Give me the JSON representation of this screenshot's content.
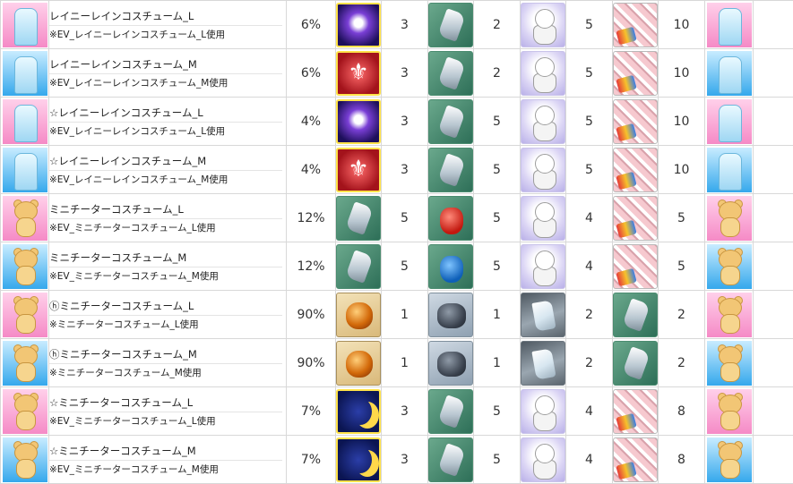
{
  "rows": [
    {
      "name": "レイニーレインコスチューム_L",
      "sub": "※EV_レイニーレインコスチューム_L使用",
      "rate": "6%",
      "costume": "pink-rain",
      "item1": "purple-orb-icon",
      "c1": "3",
      "item2": "green-crystal-icon",
      "c2": "2",
      "item3": "doll-icon",
      "c3": "5",
      "item4": "cloth-icon",
      "c4": "10",
      "result": "pink-rain"
    },
    {
      "name": "レイニーレインコスチューム_M",
      "sub": "※EV_レイニーレインコスチューム_M使用",
      "rate": "6%",
      "costume": "blue-rain",
      "item1": "red-fleur-icon",
      "c1": "3",
      "item2": "green-crystal-icon",
      "c2": "2",
      "item3": "doll-icon",
      "c3": "5",
      "item4": "cloth-icon",
      "c4": "10",
      "result": "blue-rain"
    },
    {
      "name": "☆レイニーレインコスチューム_L",
      "sub": "※EV_レイニーレインコスチューム_L使用",
      "rate": "4%",
      "costume": "pink-rain",
      "item1": "purple-orb-icon",
      "c1": "3",
      "item2": "green-crystal-icon",
      "c2": "5",
      "item3": "doll-icon",
      "c3": "5",
      "item4": "cloth-icon",
      "c4": "10",
      "result": "pink-rain"
    },
    {
      "name": "☆レイニーレインコスチューム_M",
      "sub": "※EV_レイニーレインコスチューム_M使用",
      "rate": "4%",
      "costume": "blue-rain",
      "item1": "red-fleur-icon",
      "c1": "3",
      "item2": "green-crystal-icon",
      "c2": "5",
      "item3": "doll-icon",
      "c3": "5",
      "item4": "cloth-icon",
      "c4": "10",
      "result": "blue-rain"
    },
    {
      "name": "ミニチーターコスチューム_L",
      "sub": "※EV_ミニチーターコスチューム_L使用",
      "rate": "12%",
      "costume": "pink-bear",
      "item1": "green-crystal-icon",
      "c1": "5",
      "item2": "red-bag-icon",
      "c2": "5",
      "item3": "doll-icon",
      "c3": "4",
      "item4": "cloth-icon",
      "c4": "5",
      "result": "pink-bear"
    },
    {
      "name": "ミニチーターコスチューム_M",
      "sub": "※EV_ミニチーターコスチューム_M使用",
      "rate": "12%",
      "costume": "blue-bear",
      "item1": "green-crystal-icon",
      "c1": "5",
      "item2": "blue-bag-icon",
      "c2": "5",
      "item3": "doll-icon",
      "c3": "4",
      "item4": "cloth-icon",
      "c4": "5",
      "result": "blue-bear"
    },
    {
      "name": "ⓗミニチーターコスチューム_L",
      "sub": "※ミニチーターコスチューム_L使用",
      "rate": "90%",
      "costume": "pink-bear",
      "item1": "orange-ore-icon",
      "c1": "1",
      "item2": "dark-rock-icon",
      "c2": "1",
      "item3": "white-crystal-icon",
      "c3": "2",
      "item4": "green-crystal-icon",
      "c4": "2",
      "result": "pink-bear"
    },
    {
      "name": "ⓗミニチーターコスチューム_M",
      "sub": "※ミニチーターコスチューム_M使用",
      "rate": "90%",
      "costume": "blue-bear",
      "item1": "orange-ore-icon",
      "c1": "1",
      "item2": "dark-rock-icon",
      "c2": "1",
      "item3": "white-crystal-icon",
      "c3": "2",
      "item4": "green-crystal-icon",
      "c4": "2",
      "result": "blue-bear"
    },
    {
      "name": "☆ミニチーターコスチューム_L",
      "sub": "※EV_ミニチーターコスチューム_L使用",
      "rate": "7%",
      "costume": "pink-bear",
      "item1": "moon-icon",
      "c1": "3",
      "item2": "green-crystal-icon",
      "c2": "5",
      "item3": "doll-icon",
      "c3": "4",
      "item4": "cloth-icon",
      "c4": "8",
      "result": "pink-bear"
    },
    {
      "name": "☆ミニチーターコスチューム_M",
      "sub": "※EV_ミニチーターコスチューム_M使用",
      "rate": "7%",
      "costume": "blue-bear",
      "item1": "moon-icon",
      "c1": "3",
      "item2": "green-crystal-icon",
      "c2": "5",
      "item3": "doll-icon",
      "c3": "4",
      "item4": "cloth-icon",
      "c4": "8",
      "result": "blue-bear"
    }
  ],
  "fleur_glyph": "⚜"
}
